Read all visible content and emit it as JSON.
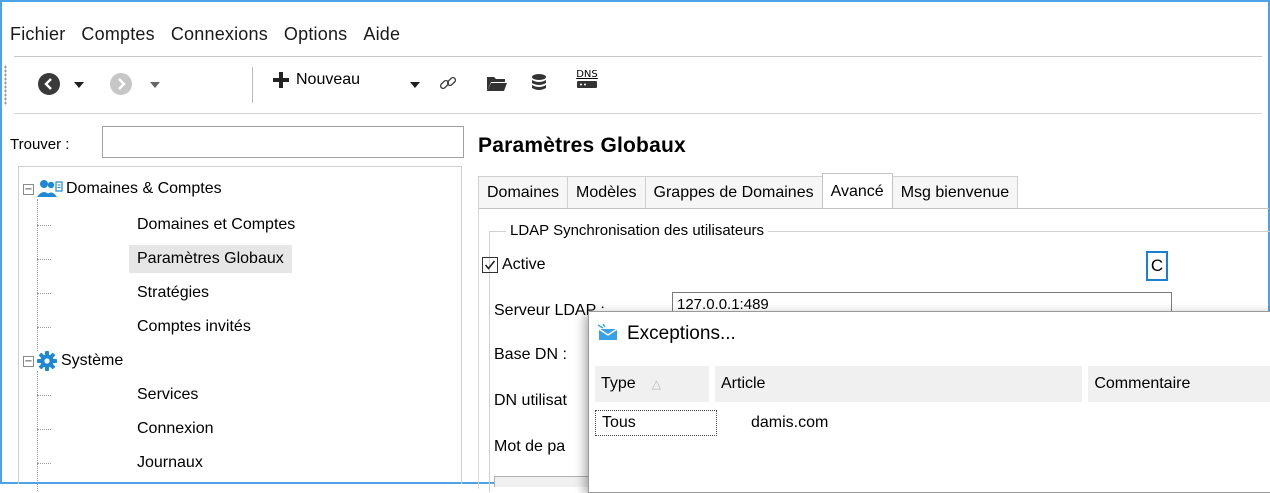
{
  "menu": [
    "Fichier",
    "Comptes",
    "Connexions",
    "Options",
    "Aide"
  ],
  "toolbar": {
    "back_icon": "back-arrow-icon",
    "forward_icon": "forward-arrow-icon",
    "new_label": "Nouveau",
    "dns_label": "DNS"
  },
  "search": {
    "label": "Trouver :",
    "value": ""
  },
  "tree": {
    "domaines": {
      "label": "Domaines & Comptes",
      "children": [
        "Domaines et Comptes",
        "Paramètres Globaux",
        "Stratégies",
        "Comptes invités"
      ]
    },
    "systeme": {
      "label": "Système",
      "children": [
        "Services",
        "Connexion",
        "Journaux"
      ]
    },
    "selected": "Paramètres Globaux"
  },
  "page": {
    "title": "Paramètres Globaux"
  },
  "tabs": [
    "Domaines",
    "Modèles",
    "Grappes de Domaines",
    "Avancé",
    "Msg bienvenue"
  ],
  "active_tab": "Avancé",
  "ldap": {
    "group_title": "LDAP Synchronisation des utilisateurs",
    "active_label": "Active",
    "active_checked": true,
    "c_button": "C",
    "server_label": "Serveur LDAP :",
    "server_value": "127.0.0.1:489",
    "base_dn_label": "Base DN :",
    "dn_user_label": "DN utilisat",
    "password_label": "Mot de pa"
  },
  "dialog": {
    "title": "Exceptions...",
    "columns": [
      "Type",
      "Article",
      "Commentaire"
    ],
    "rows": [
      {
        "type": "Tous",
        "article": "damis.com",
        "comment": ""
      }
    ]
  },
  "colors": {
    "accent": "#1a7fd1",
    "window_border": "#4ea3e6",
    "icon_blue": "#1e88d4"
  }
}
